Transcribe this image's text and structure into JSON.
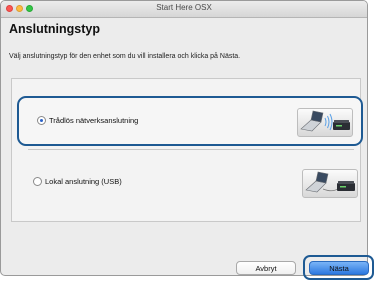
{
  "window": {
    "title": "Start Here OSX"
  },
  "heading": "Anslutningstyp",
  "instruction": "Välj anslutningstyp för den enhet som du vill installera och klicka på Nästa.",
  "options": [
    {
      "label": "Trådlös nätverksanslutning",
      "selected": true,
      "icon": "wireless-connection-icon"
    },
    {
      "label": "Lokal anslutning (USB)",
      "selected": false,
      "icon": "usb-connection-icon"
    }
  ],
  "buttons": {
    "cancel": "Avbryt",
    "next": "Nästa"
  },
  "colors": {
    "highlight": "#1e5a93",
    "default_button": "#2d79e0"
  }
}
